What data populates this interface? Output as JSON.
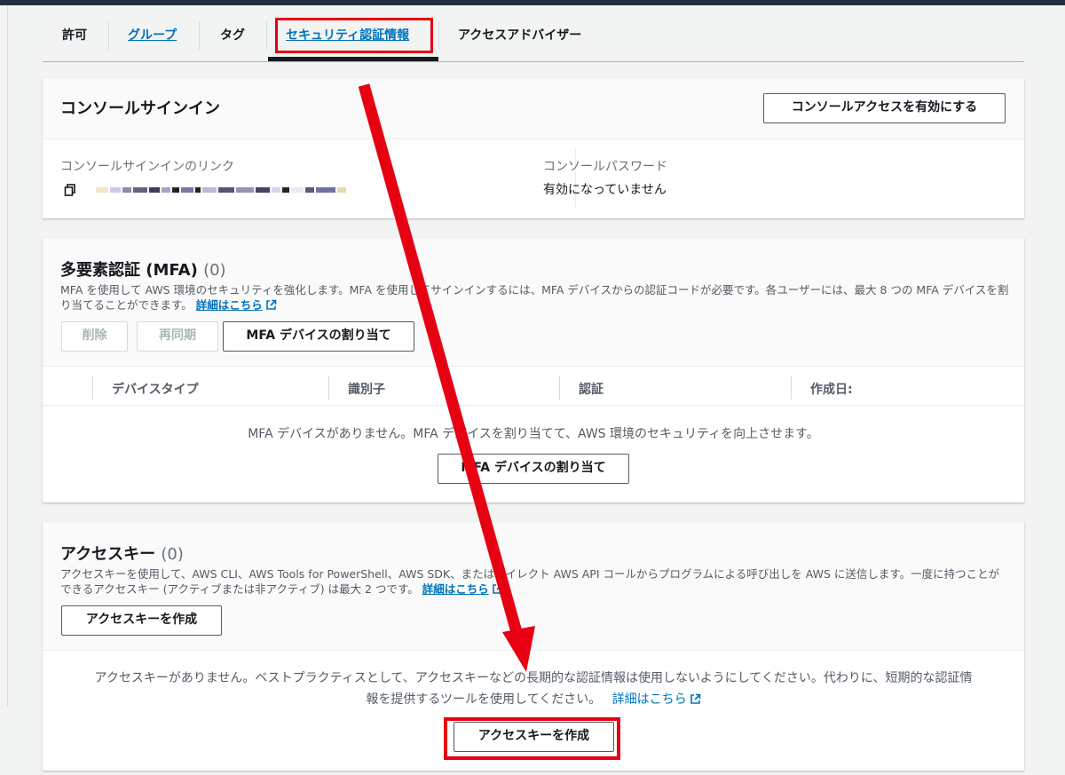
{
  "tabs": [
    {
      "label": "許可"
    },
    {
      "label": "グループ"
    },
    {
      "label": "タグ"
    },
    {
      "label": "セキュリティ認証情報"
    },
    {
      "label": "アクセスアドバイザー"
    }
  ],
  "console": {
    "title": "コンソールサインイン",
    "enable_button": "コンソールアクセスを有効にする",
    "link_label": "コンソールサインインのリンク",
    "password_label": "コンソールパスワード",
    "password_value": "有効になっていません"
  },
  "mfa": {
    "title": "多要素認証 (MFA)",
    "count": "(0)",
    "description": "MFA を使用して AWS 環境のセキュリティを強化します。MFA を使用してサインインするには、MFA デバイスからの認証コードが必要です。各ユーザーには、最大 8 つの MFA デバイスを割り当てることができます。",
    "learn_more": "詳細はこちら",
    "delete_button": "削除",
    "resync_button": "再同期",
    "assign_button": "MFA デバイスの割り当て",
    "columns": [
      "デバイスタイプ",
      "識別子",
      "認証",
      "作成日:"
    ],
    "empty_text": "MFA デバイスがありません。MFA デバイスを割り当てて、AWS 環境のセキュリティを向上させます。",
    "empty_assign_button": "MFA デバイスの割り当て"
  },
  "access_keys": {
    "title": "アクセスキー",
    "count": "(0)",
    "description": "アクセスキーを使用して、AWS CLI、AWS Tools for PowerShell、AWS SDK、またはダイレクト AWS API コールからプログラムによる呼び出しを AWS に送信します。一度に持つことができるアクセスキー (アクティブまたは非アクティブ) は最大 2 つです。",
    "learn_more": "詳細はこちら",
    "create_button": "アクセスキーを作成",
    "empty_text_line1": "アクセスキーがありません。ベストプラクティスとして、アクセスキーなどの長期的な認証情報は使用しないようにしてください。代わりに、短期的な認証情",
    "empty_text_line2": "報を提供するツールを使用してください。",
    "empty_learn_more": "詳細はこちら",
    "empty_create_button": "アクセスキーを作成"
  },
  "colors": {
    "link": "#0073bb",
    "highlight": "#e60012",
    "text": "#16191f",
    "muted": "#545b64"
  }
}
